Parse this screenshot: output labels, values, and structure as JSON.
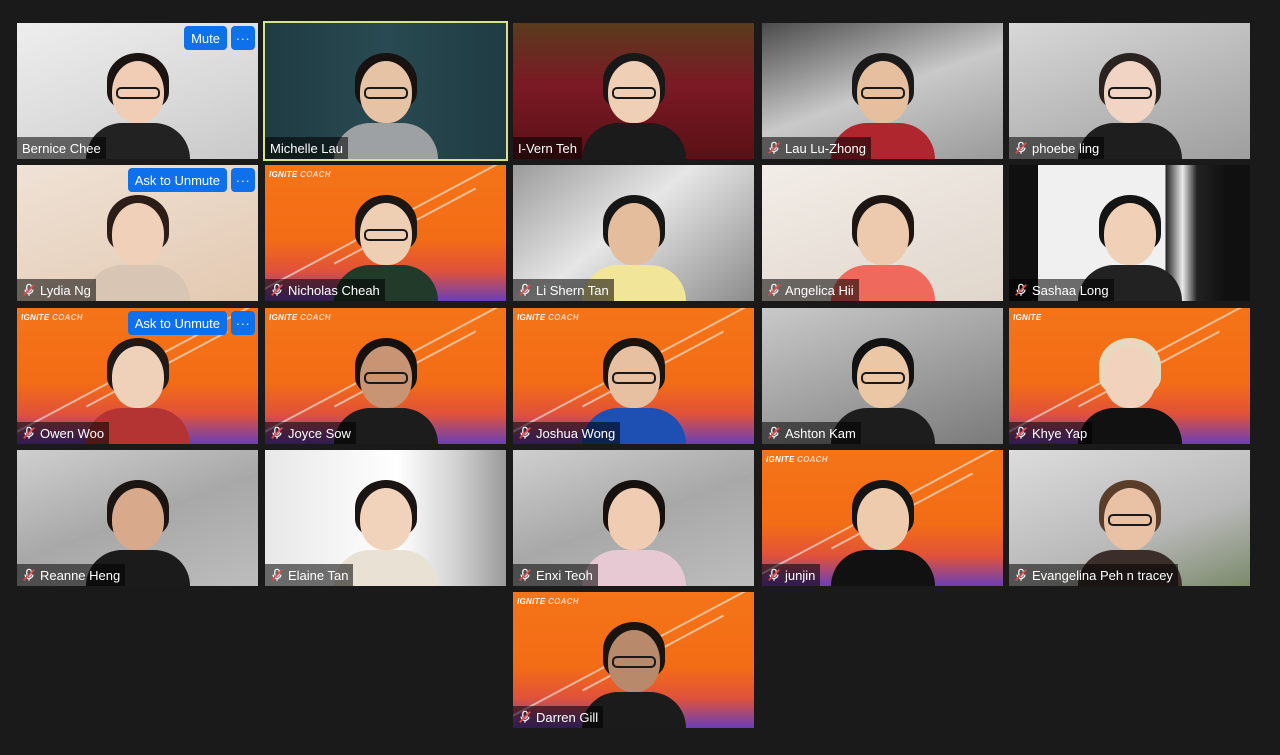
{
  "participants": [
    {
      "name": "Bernice Chee",
      "muted": false,
      "bg": "wall",
      "skin": "#f0cdb4",
      "hair": "#1b1412",
      "shirt": "#222222",
      "glasses": true,
      "controls": {
        "primary": "Mute",
        "more": "···"
      }
    },
    {
      "name": "Michelle Lau",
      "muted": false,
      "active": true,
      "bg": "teal",
      "skin": "#e7c3a5",
      "hair": "#17110f",
      "shirt": "#9ea1a4",
      "glasses": true
    },
    {
      "name": "I-Vern Teh",
      "muted": false,
      "bg": "theatre",
      "skin": "#efcfb5",
      "hair": "#181818",
      "shirt": "#1b1b1b",
      "glasses": true
    },
    {
      "name": "Lau Lu-Zhong",
      "muted": true,
      "bg": "gaming",
      "skin": "#e6bf9e",
      "hair": "#1a1a1a",
      "shirt": "#b0262f",
      "glasses": true
    },
    {
      "name": "phoebe ling",
      "muted": true,
      "bg": "room",
      "skin": "#f1d4c3",
      "hair": "#2a2320",
      "shirt": "#1e1e1e",
      "glasses": true
    },
    {
      "name": "Lydia Ng",
      "muted": true,
      "bg": "peach",
      "skin": "#f0d0b8",
      "hair": "#2c1d16",
      "shirt": "#d9c5b3",
      "glasses": false,
      "controls": {
        "primary": "Ask to Unmute",
        "more": "···"
      }
    },
    {
      "name": "Nicholas Cheah",
      "muted": true,
      "bg": "ignite",
      "logo": "IGNITE COACH",
      "skin": "#efcfb3",
      "hair": "#1c1714",
      "shirt": "#213a2a",
      "glasses": true
    },
    {
      "name": "Li Shern Tan",
      "muted": true,
      "bg": "blurred",
      "skin": "#e3bd9c",
      "hair": "#161616",
      "shirt": "#f1e59a",
      "glasses": false
    },
    {
      "name": "Angelica Hii",
      "muted": true,
      "bg": "light",
      "skin": "#edc9ad",
      "hair": "#1c1512",
      "shirt": "#ef6a5c",
      "glasses": false
    },
    {
      "name": "Sashaa Long",
      "muted": true,
      "bg": "curtain",
      "skin": "#f0d0b6",
      "hair": "#141414",
      "shirt": "#222222",
      "glasses": false
    },
    {
      "name": "Owen Woo",
      "muted": true,
      "bg": "ignite",
      "logo": "IGNITE COACH",
      "skin": "#efd0b8",
      "hair": "#201915",
      "shirt": "#b43434",
      "glasses": false,
      "controls": {
        "primary": "Ask to Unmute",
        "more": "···"
      }
    },
    {
      "name": "Joyce Sow",
      "muted": true,
      "bg": "ignite",
      "logo": "IGNITE COACH",
      "skin": "#c99474",
      "hair": "#16110f",
      "shirt": "#1c1c1c",
      "glasses": true
    },
    {
      "name": "Joshua Wong",
      "muted": true,
      "bg": "ignite",
      "logo": "IGNITE COACH",
      "skin": "#e6c0a0",
      "hair": "#1a1410",
      "shirt": "#1e4fb3",
      "glasses": true
    },
    {
      "name": "Ashton Kam",
      "muted": true,
      "bg": "office",
      "skin": "#ebc7a6",
      "hair": "#121212",
      "shirt": "#1d1d1d",
      "glasses": true
    },
    {
      "name": "Khye Yap",
      "muted": true,
      "bg": "ignite",
      "logo": "IGNITE",
      "skin": "#f1d3bd",
      "hair": "#e6d9bf",
      "shirt": "#111111",
      "glasses": false
    },
    {
      "name": "Reanne Heng",
      "muted": true,
      "bg": "poster",
      "skin": "#d8a98a",
      "hair": "#1a1412",
      "shirt": "#1b1b1b",
      "glasses": false
    },
    {
      "name": "Elaine Tan",
      "muted": true,
      "bg": "shelf",
      "skin": "#f1d2ba",
      "hair": "#1a1412",
      "shirt": "#e9e2d4",
      "glasses": false
    },
    {
      "name": "Enxi Teoh",
      "muted": true,
      "bg": "poster",
      "skin": "#f0cdb2",
      "hair": "#16110f",
      "shirt": "#e7c9d4",
      "glasses": false
    },
    {
      "name": "junjin",
      "muted": true,
      "bg": "ignite",
      "logo": "IGNITE COACH",
      "skin": "#efcbad",
      "hair": "#141414",
      "shirt": "#111111",
      "glasses": false
    },
    {
      "name": "Evangelina Peh n tracey",
      "muted": true,
      "bg": "plants",
      "skin": "#e9c2a6",
      "hair": "#5a3e2a",
      "shirt": "#3a2d2a",
      "glasses": true
    },
    {
      "name": "Darren Gill",
      "muted": true,
      "bg": "ignite",
      "logo": "IGNITE COACH",
      "skin": "#b88a6b",
      "hair": "#1a1410",
      "shirt": "#1b1b1b",
      "glasses": true
    }
  ],
  "colors": {
    "background": "#1a1a1a",
    "active_speaker_border": "#d8e28a",
    "button_blue": "#0e71eb",
    "muted_icon": "#e5484d"
  }
}
